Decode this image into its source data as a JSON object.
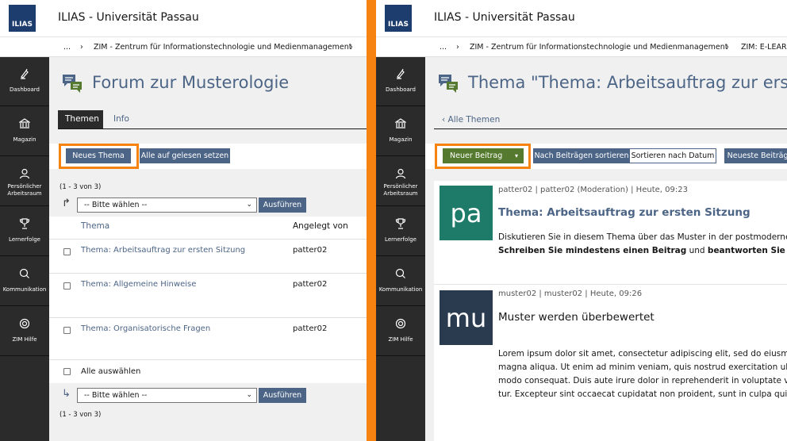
{
  "app": {
    "logo_text": "ILIAS",
    "title": "ILIAS - Universität Passau"
  },
  "colors": {
    "accent": "#4c6586",
    "highlight": "#f6830f",
    "mainbar": "#2b2b2b",
    "green_button": "#557a2f",
    "avatar_pa": "#1e7b6a",
    "avatar_mu": "#2a3a4f"
  },
  "mainbar": [
    {
      "label": "Dashboard",
      "icon": "dashboard-icon"
    },
    {
      "label": "Magazin",
      "icon": "repository-icon"
    },
    {
      "label": "Persönlicher Arbeitsraum",
      "icon": "person-icon"
    },
    {
      "label": "Lernerfolge",
      "icon": "trophy-icon"
    },
    {
      "label": "Kommunikation",
      "icon": "chat-icon"
    },
    {
      "label": "ZIM Hilfe",
      "icon": "lifebuoy-icon"
    }
  ],
  "left": {
    "breadcrumb": {
      "ellipsis": "...",
      "item1": "ZIM - Zentrum für Informationstechnologie und Medienmanagement",
      "item2_partial": "›"
    },
    "page_title": "Forum zur Musterologie",
    "tabs": [
      {
        "label": "Themen",
        "active": true
      },
      {
        "label": "Info",
        "active": false
      }
    ],
    "toolbar": {
      "new_topic": "Neues Thema",
      "mark_read": "Alle auf gelesen setzen"
    },
    "count_top": "(1 - 3 von 3)",
    "count_bottom": "(1 - 3 von 3)",
    "select_placeholder": "-- Bitte wählen --",
    "execute_label": "Ausführen",
    "table": {
      "col_topic": "Thema",
      "col_created": "Angelegt von",
      "rows": [
        {
          "topic": "Thema: Arbeitsauftrag zur ersten Sitzung",
          "author": "patter02"
        },
        {
          "topic": "Thema: Allgemeine Hinweise",
          "author": "patter02"
        },
        {
          "topic": "Thema: Organisatorische Fragen",
          "author": "patter02"
        }
      ],
      "select_all": "Alle auswählen"
    }
  },
  "right": {
    "breadcrumb": {
      "ellipsis": "...",
      "item1": "ZIM - Zentrum für Informationstechnologie und Medienmanagement",
      "item2": "ZIM: E-LEARN"
    },
    "page_title": "Thema \"Thema: Arbeitsauftrag zur ersten S",
    "back_link": "Alle Themen",
    "toolbar": {
      "new_post": "Neuer Beitrag",
      "sort_posts": "Nach Beiträgen sortieren",
      "sort_date": "Sortieren nach Datum",
      "newest": "Neueste Beiträge"
    },
    "posts": [
      {
        "avatar": "pa",
        "meta": "patter02 | patter02 (Moderation) | Heute, 09:23",
        "title": "Thema: Arbeitsauftrag zur ersten Sitzung",
        "body1": "Diskutieren Sie in diesem Thema über das Muster in der postmodernen",
        "body2_bold1": "Schreiben Sie mindestens einen Beitrag",
        "body2_mid": " und ",
        "body2_bold2": "beantworten Sie minde"
      },
      {
        "avatar": "mu",
        "meta": "muster02 | muster02 | Heute, 09:26",
        "title": "Muster werden überbewertet",
        "lines": [
          "Lorem ipsum dolor sit amet, consectetur adipiscing elit, sed do eiusmod",
          "magna aliqua. Ut enim ad minim veniam, quis nostrud exercitation ullam",
          "modo consequat. Duis aute irure dolor in reprehenderit in voluptate veli",
          "tur. Excepteur sint occaecat cupidatat non proident, sunt in culpa qui"
        ]
      }
    ]
  }
}
